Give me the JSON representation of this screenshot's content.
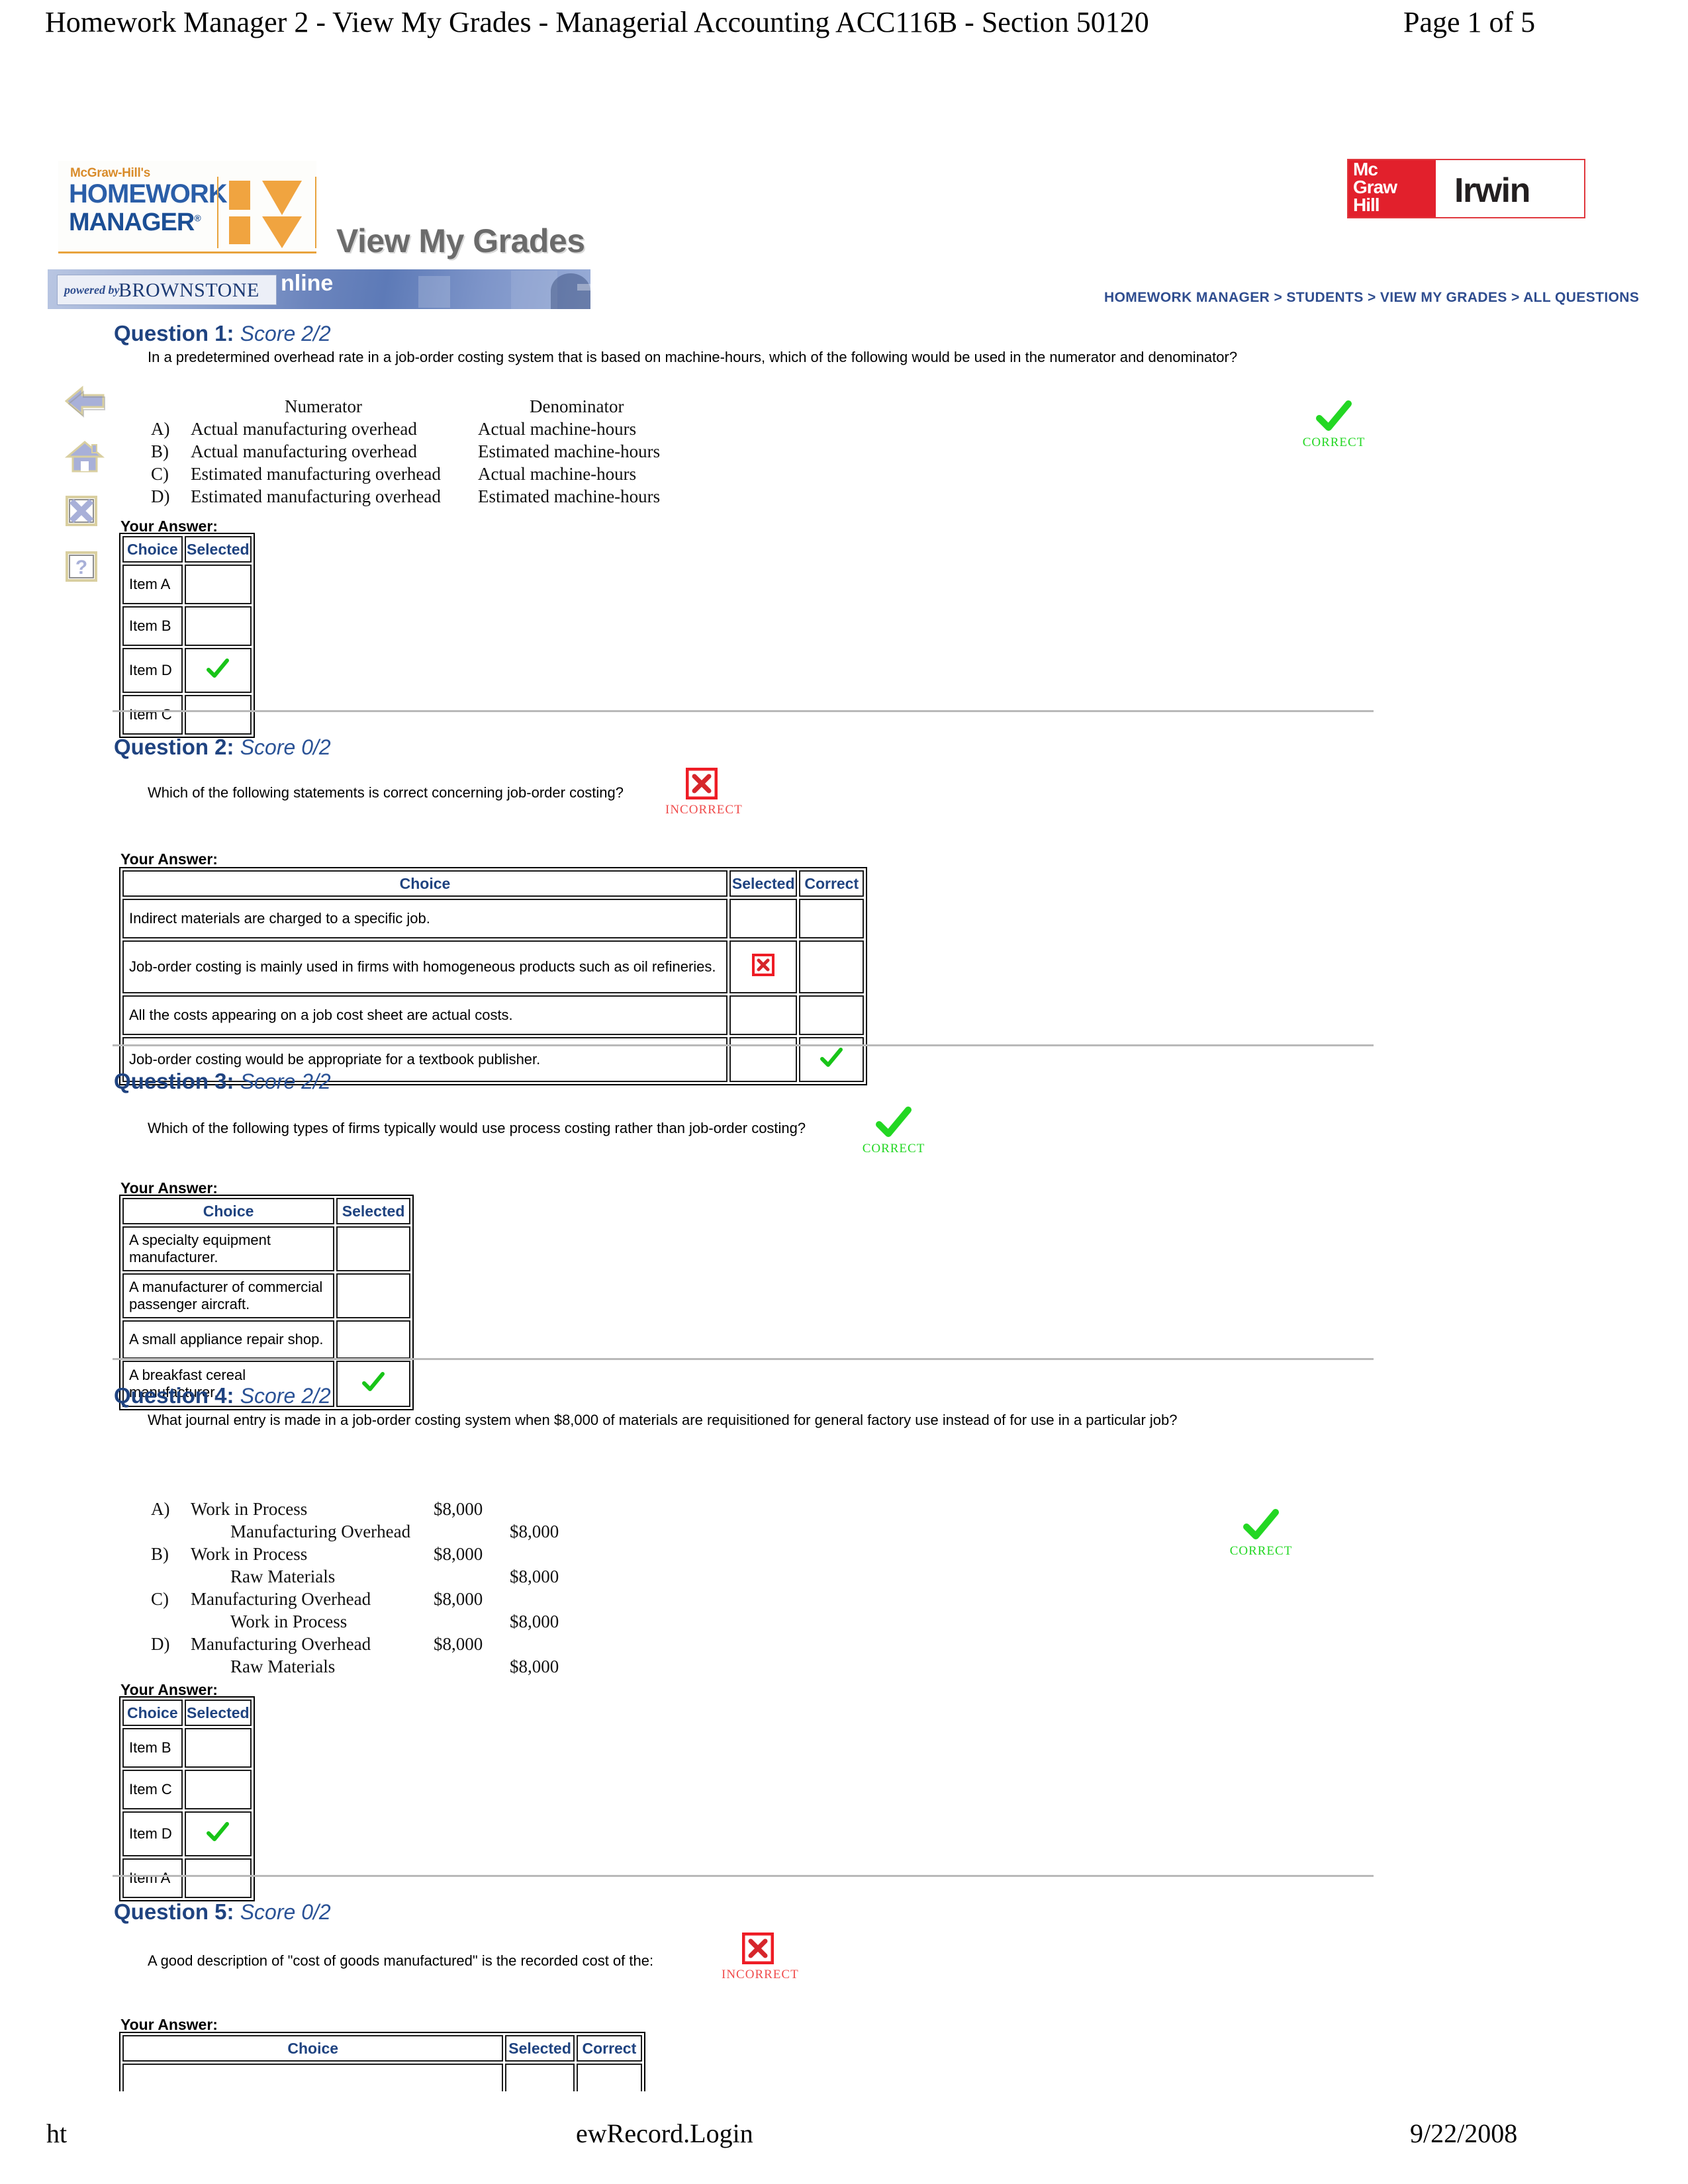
{
  "print": {
    "header_title": "Homework Manager 2 - View My Grades - Managerial Accounting ACC116B - Section 50120",
    "header_page": "Page 1 of 5",
    "footer_left": "ht",
    "footer_center": "ewRecord.Login",
    "footer_right": "9/22/2008"
  },
  "brand": {
    "mcgraw_hill_pre": "McGraw-Hill's",
    "homework": "HOMEWORK",
    "manager": "MANAGER",
    "manager_reg": "®",
    "page_title": "View My Grades",
    "powered_by": "powered by",
    "brownstone": "BROWNSTONE",
    "online_fragment": "nline",
    "mhi_mc": "Mc",
    "mhi_graw": "Graw",
    "mhi_hill": "Hill",
    "mhi_irwin": "Irwin",
    "breadcrumb": "HOMEWORK MANAGER > STUDENTS > VIEW MY GRADES > ALL QUESTIONS"
  },
  "sidebar": {
    "items": [
      {
        "icon": "back-arrow-icon",
        "label": "Back"
      },
      {
        "icon": "home-icon",
        "label": "Home"
      },
      {
        "icon": "close-x-icon",
        "label": "Close"
      },
      {
        "icon": "help-question-icon",
        "label": "Help"
      }
    ]
  },
  "labels": {
    "your_answer": "Your Answer:",
    "col_choice": "Choice",
    "col_selected": "Selected",
    "col_correct": "Correct",
    "badge_correct": "CORRECT",
    "badge_incorrect": "INCORRECT"
  },
  "colors": {
    "heading_blue": "#1f4380",
    "breadcrumb_blue": "#2f4d8f",
    "correct_green": "#23d723",
    "incorrect_red": "#f04c4c",
    "brand_orange": "#f0a440",
    "mcgraw_red": "#e2202c"
  },
  "questions": [
    {
      "id": "q1",
      "title": "Question 1:",
      "score": "Score 2/2",
      "prompt": "In a predetermined overhead rate in a job-order costing system that is based on machine-hours, which of the following would be used in the numerator and denominator?",
      "result": "correct",
      "stem_table": {
        "headers": [
          "Numerator",
          "Denominator"
        ],
        "rows": [
          {
            "letter": "A)",
            "numerator": "Actual manufacturing overhead",
            "denominator": "Actual machine-hours"
          },
          {
            "letter": "B)",
            "numerator": "Actual manufacturing overhead",
            "denominator": "Estimated machine-hours"
          },
          {
            "letter": "C)",
            "numerator": "Estimated manufacturing overhead",
            "denominator": "Actual machine-hours"
          },
          {
            "letter": "D)",
            "numerator": "Estimated manufacturing overhead",
            "denominator": "Estimated machine-hours"
          }
        ]
      },
      "answer_table": {
        "columns": [
          "Choice",
          "Selected"
        ],
        "rows": [
          {
            "choice": "Item A",
            "selected": "",
            "correct": ""
          },
          {
            "choice": "Item B",
            "selected": "",
            "correct": ""
          },
          {
            "choice": "Item D",
            "selected": "check",
            "correct": ""
          },
          {
            "choice": "Item C",
            "selected": "",
            "correct": ""
          }
        ]
      }
    },
    {
      "id": "q2",
      "title": "Question 2:",
      "score": "Score 0/2",
      "prompt": "Which of the following statements is correct concerning job-order costing?",
      "result": "incorrect",
      "answer_table": {
        "columns": [
          "Choice",
          "Selected",
          "Correct"
        ],
        "rows": [
          {
            "choice": "Indirect materials are charged to a specific job.",
            "selected": "",
            "correct": ""
          },
          {
            "choice": "Job-order costing is mainly used in firms with homogeneous products such as oil refineries.",
            "selected": "x",
            "correct": ""
          },
          {
            "choice": "All the costs appearing on a job cost sheet are actual costs.",
            "selected": "",
            "correct": ""
          },
          {
            "choice": "Job-order costing would be appropriate for a textbook publisher.",
            "selected": "",
            "correct": "check"
          }
        ]
      }
    },
    {
      "id": "q3",
      "title": "Question 3:",
      "score": "Score 2/2",
      "prompt": "Which of the following types of firms typically would use process costing rather than job-order costing?",
      "result": "correct",
      "answer_table": {
        "columns": [
          "Choice",
          "Selected"
        ],
        "rows": [
          {
            "choice": "A specialty equipment manufacturer.",
            "selected": "",
            "correct": ""
          },
          {
            "choice": "A manufacturer of commercial passenger aircraft.",
            "selected": "",
            "correct": ""
          },
          {
            "choice": "A small appliance repair shop.",
            "selected": "",
            "correct": ""
          },
          {
            "choice": "A breakfast cereal manufacturer.",
            "selected": "check",
            "correct": ""
          }
        ]
      }
    },
    {
      "id": "q4",
      "title": "Question 4:",
      "score": "Score 2/2",
      "prompt": "What journal entry is made in a job-order costing system when $8,000 of materials are requisitioned for general factory use instead of for use in a particular job?",
      "result": "correct",
      "journal": [
        {
          "letter": "A)",
          "debit_account": "Work in Process",
          "debit_amount": "$8,000",
          "credit_account": "Manufacturing Overhead",
          "credit_amount": "$8,000"
        },
        {
          "letter": "B)",
          "debit_account": "Work in Process",
          "debit_amount": "$8,000",
          "credit_account": "Raw Materials",
          "credit_amount": "$8,000"
        },
        {
          "letter": "C)",
          "debit_account": "Manufacturing Overhead",
          "debit_amount": "$8,000",
          "credit_account": "Work in Process",
          "credit_amount": "$8,000"
        },
        {
          "letter": "D)",
          "debit_account": "Manufacturing Overhead",
          "debit_amount": "$8,000",
          "credit_account": "Raw Materials",
          "credit_amount": "$8,000"
        }
      ],
      "answer_table": {
        "columns": [
          "Choice",
          "Selected"
        ],
        "rows": [
          {
            "choice": "Item B",
            "selected": "",
            "correct": ""
          },
          {
            "choice": "Item C",
            "selected": "",
            "correct": ""
          },
          {
            "choice": "Item D",
            "selected": "check",
            "correct": ""
          },
          {
            "choice": "Item A",
            "selected": "",
            "correct": ""
          }
        ]
      }
    },
    {
      "id": "q5",
      "title": "Question 5:",
      "score": "Score 0/2",
      "prompt": "A good description of \"cost of goods manufactured\" is the recorded cost of the:",
      "result": "incorrect",
      "answer_table": {
        "columns": [
          "Choice",
          "Selected",
          "Correct"
        ],
        "rows": [
          {
            "choice": "",
            "selected": "",
            "correct": ""
          }
        ]
      }
    }
  ]
}
